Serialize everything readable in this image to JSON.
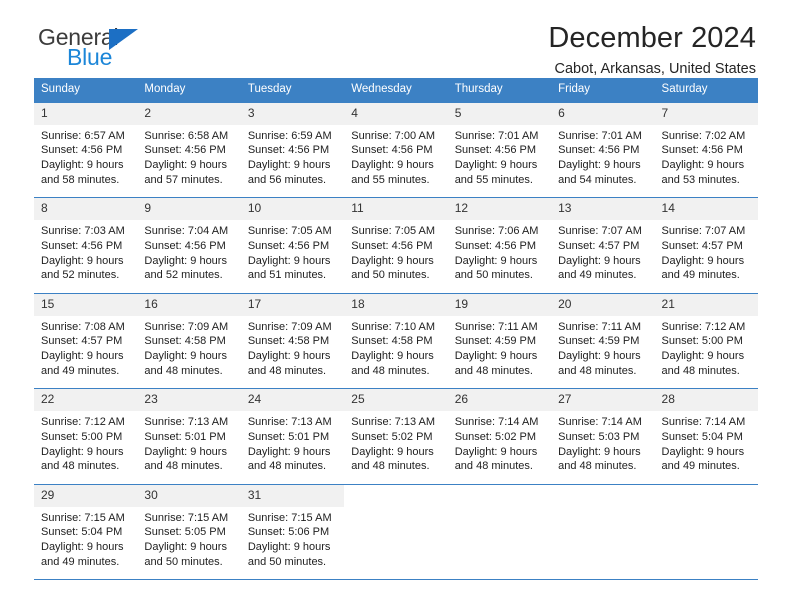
{
  "brand": {
    "line1": "General",
    "line2": "Blue",
    "triangle_icon": "brand-triangle-icon",
    "accent_dark": "#1c6fc4",
    "accent_light": "#1c86d8"
  },
  "header": {
    "month_title": "December 2024",
    "location": "Cabot, Arkansas, United States"
  },
  "theme": {
    "header_bg": "#3c81c4",
    "daynum_bg": "#f1f1f1",
    "text": "#1e1e1e"
  },
  "calendar": {
    "weekday_headers": [
      "Sunday",
      "Monday",
      "Tuesday",
      "Wednesday",
      "Thursday",
      "Friday",
      "Saturday"
    ],
    "weeks": [
      [
        {
          "day": "1",
          "sunrise": "Sunrise: 6:57 AM",
          "sunset": "Sunset: 4:56 PM",
          "daylight1": "Daylight: 9 hours",
          "daylight2": "and 58 minutes."
        },
        {
          "day": "2",
          "sunrise": "Sunrise: 6:58 AM",
          "sunset": "Sunset: 4:56 PM",
          "daylight1": "Daylight: 9 hours",
          "daylight2": "and 57 minutes."
        },
        {
          "day": "3",
          "sunrise": "Sunrise: 6:59 AM",
          "sunset": "Sunset: 4:56 PM",
          "daylight1": "Daylight: 9 hours",
          "daylight2": "and 56 minutes."
        },
        {
          "day": "4",
          "sunrise": "Sunrise: 7:00 AM",
          "sunset": "Sunset: 4:56 PM",
          "daylight1": "Daylight: 9 hours",
          "daylight2": "and 55 minutes."
        },
        {
          "day": "5",
          "sunrise": "Sunrise: 7:01 AM",
          "sunset": "Sunset: 4:56 PM",
          "daylight1": "Daylight: 9 hours",
          "daylight2": "and 55 minutes."
        },
        {
          "day": "6",
          "sunrise": "Sunrise: 7:01 AM",
          "sunset": "Sunset: 4:56 PM",
          "daylight1": "Daylight: 9 hours",
          "daylight2": "and 54 minutes."
        },
        {
          "day": "7",
          "sunrise": "Sunrise: 7:02 AM",
          "sunset": "Sunset: 4:56 PM",
          "daylight1": "Daylight: 9 hours",
          "daylight2": "and 53 minutes."
        }
      ],
      [
        {
          "day": "8",
          "sunrise": "Sunrise: 7:03 AM",
          "sunset": "Sunset: 4:56 PM",
          "daylight1": "Daylight: 9 hours",
          "daylight2": "and 52 minutes."
        },
        {
          "day": "9",
          "sunrise": "Sunrise: 7:04 AM",
          "sunset": "Sunset: 4:56 PM",
          "daylight1": "Daylight: 9 hours",
          "daylight2": "and 52 minutes."
        },
        {
          "day": "10",
          "sunrise": "Sunrise: 7:05 AM",
          "sunset": "Sunset: 4:56 PM",
          "daylight1": "Daylight: 9 hours",
          "daylight2": "and 51 minutes."
        },
        {
          "day": "11",
          "sunrise": "Sunrise: 7:05 AM",
          "sunset": "Sunset: 4:56 PM",
          "daylight1": "Daylight: 9 hours",
          "daylight2": "and 50 minutes."
        },
        {
          "day": "12",
          "sunrise": "Sunrise: 7:06 AM",
          "sunset": "Sunset: 4:56 PM",
          "daylight1": "Daylight: 9 hours",
          "daylight2": "and 50 minutes."
        },
        {
          "day": "13",
          "sunrise": "Sunrise: 7:07 AM",
          "sunset": "Sunset: 4:57 PM",
          "daylight1": "Daylight: 9 hours",
          "daylight2": "and 49 minutes."
        },
        {
          "day": "14",
          "sunrise": "Sunrise: 7:07 AM",
          "sunset": "Sunset: 4:57 PM",
          "daylight1": "Daylight: 9 hours",
          "daylight2": "and 49 minutes."
        }
      ],
      [
        {
          "day": "15",
          "sunrise": "Sunrise: 7:08 AM",
          "sunset": "Sunset: 4:57 PM",
          "daylight1": "Daylight: 9 hours",
          "daylight2": "and 49 minutes."
        },
        {
          "day": "16",
          "sunrise": "Sunrise: 7:09 AM",
          "sunset": "Sunset: 4:58 PM",
          "daylight1": "Daylight: 9 hours",
          "daylight2": "and 48 minutes."
        },
        {
          "day": "17",
          "sunrise": "Sunrise: 7:09 AM",
          "sunset": "Sunset: 4:58 PM",
          "daylight1": "Daylight: 9 hours",
          "daylight2": "and 48 minutes."
        },
        {
          "day": "18",
          "sunrise": "Sunrise: 7:10 AM",
          "sunset": "Sunset: 4:58 PM",
          "daylight1": "Daylight: 9 hours",
          "daylight2": "and 48 minutes."
        },
        {
          "day": "19",
          "sunrise": "Sunrise: 7:11 AM",
          "sunset": "Sunset: 4:59 PM",
          "daylight1": "Daylight: 9 hours",
          "daylight2": "and 48 minutes."
        },
        {
          "day": "20",
          "sunrise": "Sunrise: 7:11 AM",
          "sunset": "Sunset: 4:59 PM",
          "daylight1": "Daylight: 9 hours",
          "daylight2": "and 48 minutes."
        },
        {
          "day": "21",
          "sunrise": "Sunrise: 7:12 AM",
          "sunset": "Sunset: 5:00 PM",
          "daylight1": "Daylight: 9 hours",
          "daylight2": "and 48 minutes."
        }
      ],
      [
        {
          "day": "22",
          "sunrise": "Sunrise: 7:12 AM",
          "sunset": "Sunset: 5:00 PM",
          "daylight1": "Daylight: 9 hours",
          "daylight2": "and 48 minutes."
        },
        {
          "day": "23",
          "sunrise": "Sunrise: 7:13 AM",
          "sunset": "Sunset: 5:01 PM",
          "daylight1": "Daylight: 9 hours",
          "daylight2": "and 48 minutes."
        },
        {
          "day": "24",
          "sunrise": "Sunrise: 7:13 AM",
          "sunset": "Sunset: 5:01 PM",
          "daylight1": "Daylight: 9 hours",
          "daylight2": "and 48 minutes."
        },
        {
          "day": "25",
          "sunrise": "Sunrise: 7:13 AM",
          "sunset": "Sunset: 5:02 PM",
          "daylight1": "Daylight: 9 hours",
          "daylight2": "and 48 minutes."
        },
        {
          "day": "26",
          "sunrise": "Sunrise: 7:14 AM",
          "sunset": "Sunset: 5:02 PM",
          "daylight1": "Daylight: 9 hours",
          "daylight2": "and 48 minutes."
        },
        {
          "day": "27",
          "sunrise": "Sunrise: 7:14 AM",
          "sunset": "Sunset: 5:03 PM",
          "daylight1": "Daylight: 9 hours",
          "daylight2": "and 48 minutes."
        },
        {
          "day": "28",
          "sunrise": "Sunrise: 7:14 AM",
          "sunset": "Sunset: 5:04 PM",
          "daylight1": "Daylight: 9 hours",
          "daylight2": "and 49 minutes."
        }
      ],
      [
        {
          "day": "29",
          "sunrise": "Sunrise: 7:15 AM",
          "sunset": "Sunset: 5:04 PM",
          "daylight1": "Daylight: 9 hours",
          "daylight2": "and 49 minutes."
        },
        {
          "day": "30",
          "sunrise": "Sunrise: 7:15 AM",
          "sunset": "Sunset: 5:05 PM",
          "daylight1": "Daylight: 9 hours",
          "daylight2": "and 50 minutes."
        },
        {
          "day": "31",
          "sunrise": "Sunrise: 7:15 AM",
          "sunset": "Sunset: 5:06 PM",
          "daylight1": "Daylight: 9 hours",
          "daylight2": "and 50 minutes."
        },
        {
          "day": "",
          "sunrise": "",
          "sunset": "",
          "daylight1": "",
          "daylight2": ""
        },
        {
          "day": "",
          "sunrise": "",
          "sunset": "",
          "daylight1": "",
          "daylight2": ""
        },
        {
          "day": "",
          "sunrise": "",
          "sunset": "",
          "daylight1": "",
          "daylight2": ""
        },
        {
          "day": "",
          "sunrise": "",
          "sunset": "",
          "daylight1": "",
          "daylight2": ""
        }
      ]
    ]
  }
}
